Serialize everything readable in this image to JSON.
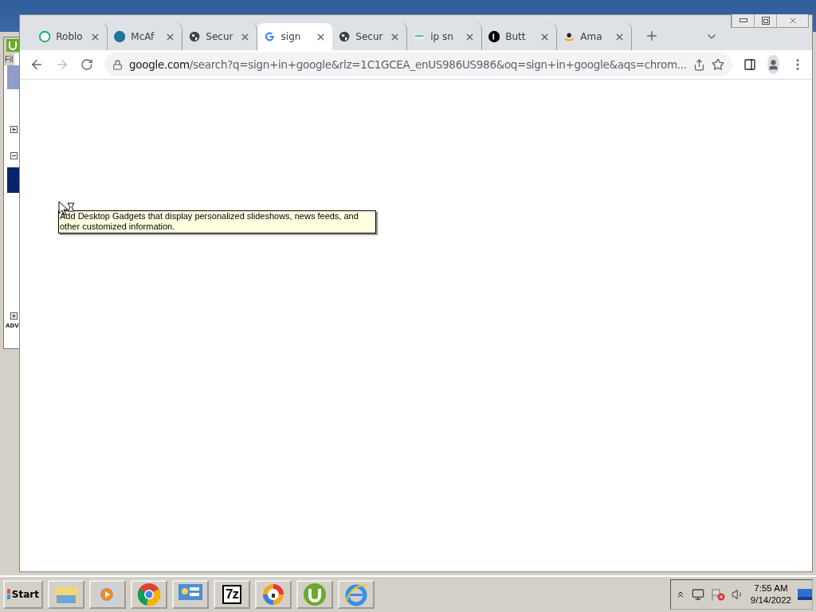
{
  "background_window": {
    "menu": "Fil",
    "footer": "ADV",
    "tree_toggles": [
      {
        "expanded": false
      },
      {
        "expanded": true
      },
      {
        "expanded": false
      }
    ]
  },
  "browser": {
    "tabs": [
      {
        "kind": "badge",
        "title": "Roblo",
        "selected": false
      },
      {
        "kind": "wordpress",
        "title": "McAf",
        "selected": false
      },
      {
        "kind": "globe",
        "title": "Secur",
        "selected": false
      },
      {
        "kind": "google",
        "title": "sign",
        "selected": true
      },
      {
        "kind": "globe",
        "title": "Secur",
        "selected": false
      },
      {
        "kind": "search",
        "title": "ip sn",
        "selected": false
      },
      {
        "kind": "circle",
        "title": "Butt",
        "selected": false
      },
      {
        "kind": "amazon",
        "title": "Ama",
        "selected": false
      }
    ],
    "address": {
      "host": "google.com",
      "path": "/search?q=sign+in+google&rlz=1C1GCEA_enUS986US986&oq=sign+in+google&aqs=chrom..."
    }
  },
  "tooltip": "Add Desktop Gadgets that display personalized slideshows, news feeds, and other customized information.",
  "taskbar": {
    "start": "Start",
    "apps": [
      {
        "kind": "folder"
      },
      {
        "kind": "media"
      },
      {
        "kind": "chrome"
      },
      {
        "kind": "panel"
      },
      {
        "kind": "sevenzip",
        "label": "7z"
      },
      {
        "kind": "vpn"
      },
      {
        "kind": "torrent"
      },
      {
        "kind": "ie"
      }
    ],
    "clock": {
      "time": "7:55 AM",
      "date": "9/14/2022"
    }
  }
}
